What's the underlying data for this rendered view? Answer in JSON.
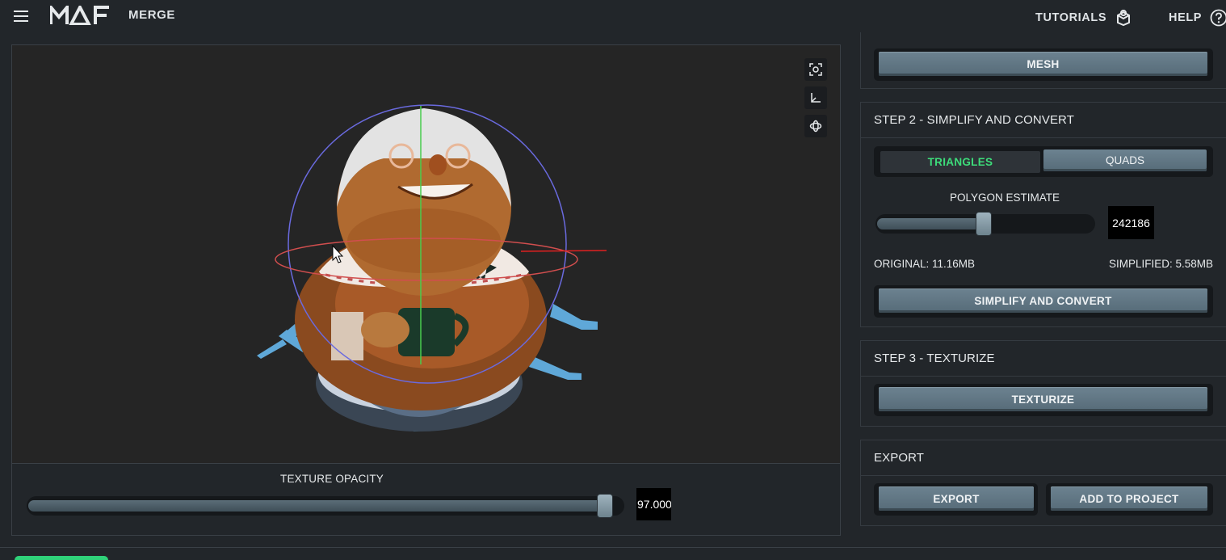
{
  "header": {
    "logo_text": "MAF",
    "app_title": "MERGE",
    "tutorials_label": "TUTORIALS",
    "help_label": "HELP"
  },
  "viewport": {
    "texture_opacity_label": "TEXTURE OPACITY",
    "texture_opacity_value": "97.0000",
    "texture_opacity_fraction": 0.97,
    "tools": [
      "focus-icon",
      "axes-icon",
      "orbit-icon"
    ]
  },
  "step1": {
    "mesh_button": "MESH"
  },
  "step2": {
    "title": "STEP 2 - SIMPLIFY AND CONVERT",
    "triangles_label": "TRIANGLES",
    "quads_label": "QUADS",
    "polygon_estimate_label": "POLYGON ESTIMATE",
    "polygon_estimate_value": "242186",
    "polygon_slider_fraction": 0.5,
    "original_label": "ORIGINAL: 11.16MB",
    "simplified_label": "SIMPLIFIED: 5.58MB",
    "simplify_button": "SIMPLIFY AND CONVERT"
  },
  "step3": {
    "title": "STEP 3 - TEXTURIZE",
    "texturize_button": "TEXTURIZE"
  },
  "export": {
    "title": "EXPORT",
    "export_button": "EXPORT",
    "add_to_project_button": "ADD TO PROJECT"
  },
  "colors": {
    "accent": "#3ddc7a",
    "background": "#22262a",
    "button": "#62788a"
  }
}
